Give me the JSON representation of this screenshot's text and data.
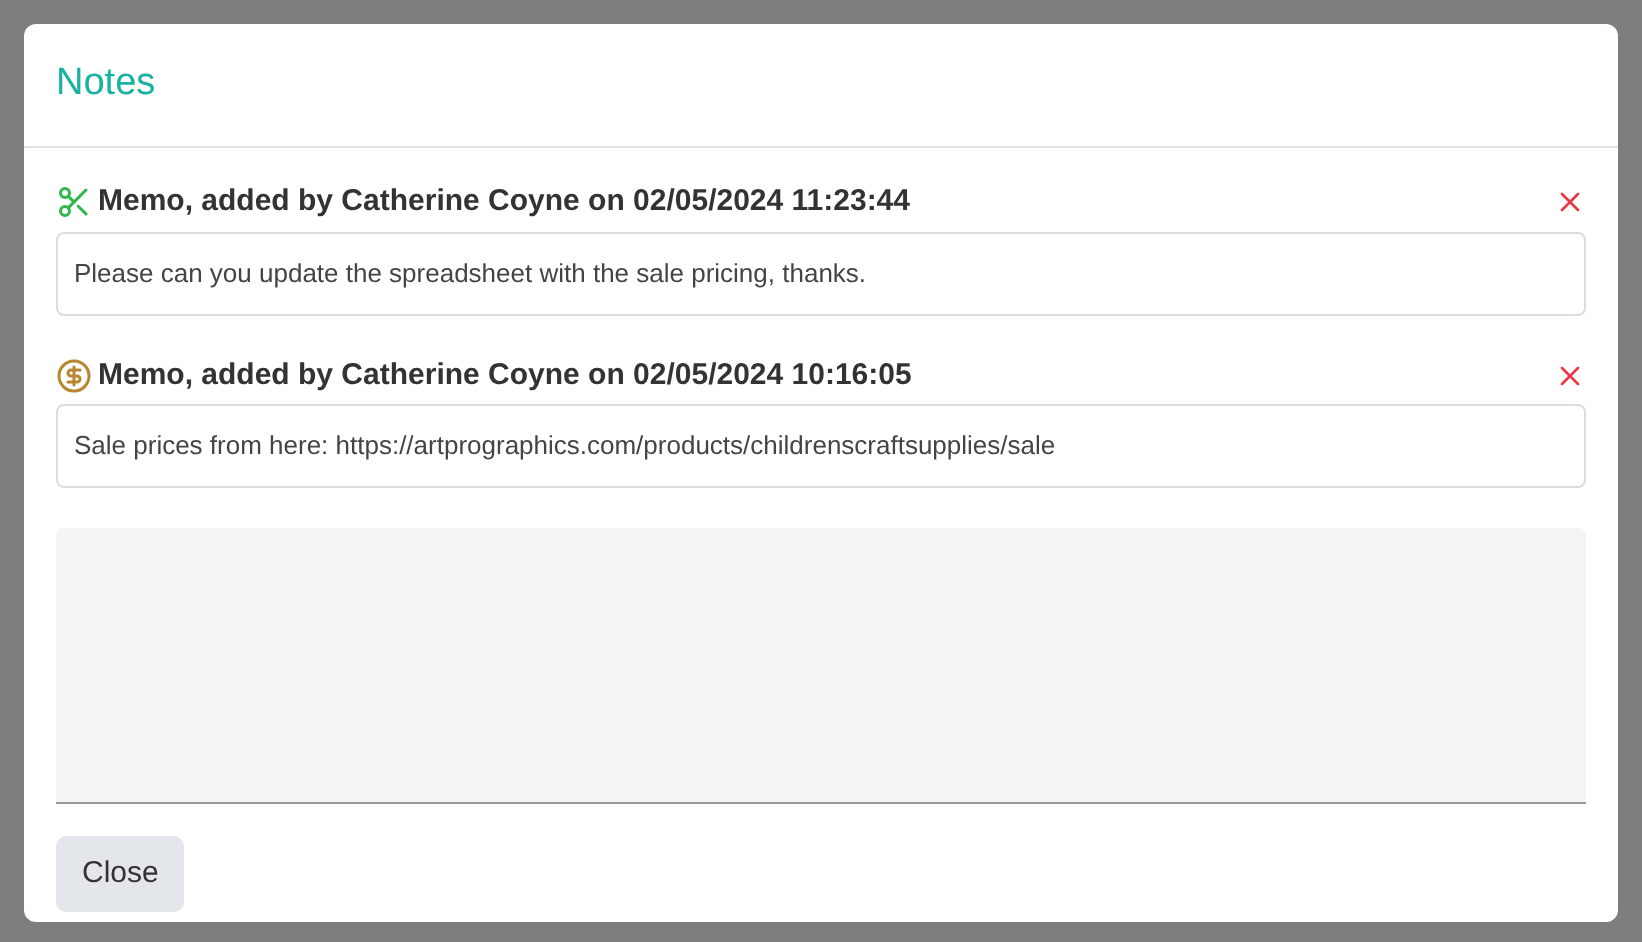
{
  "dialog": {
    "title": "Notes",
    "memos": [
      {
        "kind": "scissors",
        "heading": "Memo, added by Catherine Coyne on 02/05/2024 11:23:44",
        "text": "Please can you update the spreadsheet with the sale pricing, thanks."
      },
      {
        "kind": "dollar",
        "heading": "Memo, added by Catherine Coyne on 02/05/2024 10:16:05",
        "text": "Sale prices from here: https://artprographics.com/products/childrenscraftsupplies/sale"
      }
    ],
    "buttons": [
      "Close"
    ]
  }
}
